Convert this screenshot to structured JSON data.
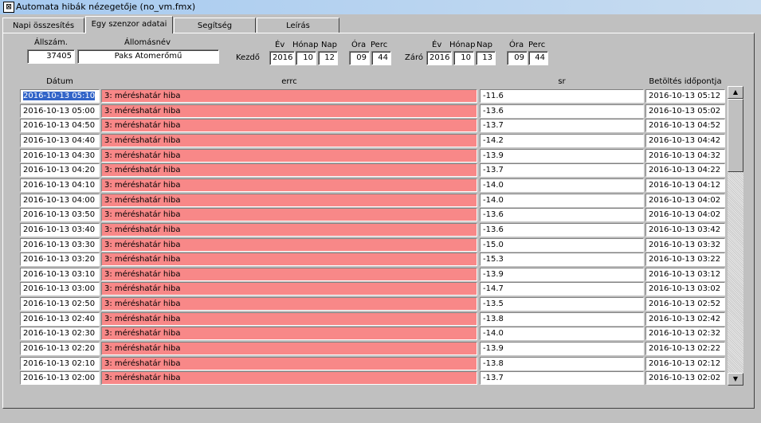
{
  "window": {
    "title": "Automata hibák nézegetője (no_vm.fmx)",
    "icon": "app-form-icon"
  },
  "tabs": [
    {
      "label": "Napi összesítés"
    },
    {
      "label": "Egy szenzor adatai"
    },
    {
      "label": "Segítség"
    },
    {
      "label": "Leírás"
    }
  ],
  "active_tab": "Egy szenzor adatai",
  "station": {
    "id_label": "Állszám.",
    "id_value": "37405",
    "name_label": "Állomásnév",
    "name_value": "Paks Atomerőmű"
  },
  "start": {
    "label": "Kezdő",
    "year_label": "Év",
    "month_label": "Hónap",
    "day_label": "Nap",
    "hour_label": "Óra",
    "minute_label": "Perc",
    "year": "2016",
    "month": "10",
    "day": "12",
    "hour": "09",
    "minute": "44"
  },
  "end": {
    "label": "Záró",
    "year_label": "Év",
    "month_label": "Hónap",
    "day_label": "Nap",
    "hour_label": "Óra",
    "minute_label": "Perc",
    "year": "2016",
    "month": "10",
    "day": "13",
    "hour": "09",
    "minute": "44"
  },
  "table": {
    "headers": {
      "date": "Dátum",
      "errc": "errc",
      "sr": "sr",
      "load": "Betöltés időpontja"
    },
    "rows": [
      {
        "date": "2016-10-13 05:10",
        "errc": "3: méréshatár hiba",
        "sr": "-11.6",
        "load": "2016-10-13 05:12"
      },
      {
        "date": "2016-10-13 05:00",
        "errc": "3: méréshatár hiba",
        "sr": "-13.6",
        "load": "2016-10-13 05:02"
      },
      {
        "date": "2016-10-13 04:50",
        "errc": "3: méréshatár hiba",
        "sr": "-13.7",
        "load": "2016-10-13 04:52"
      },
      {
        "date": "2016-10-13 04:40",
        "errc": "3: méréshatár hiba",
        "sr": "-14.2",
        "load": "2016-10-13 04:42"
      },
      {
        "date": "2016-10-13 04:30",
        "errc": "3: méréshatár hiba",
        "sr": "-13.9",
        "load": "2016-10-13 04:32"
      },
      {
        "date": "2016-10-13 04:20",
        "errc": "3: méréshatár hiba",
        "sr": "-13.7",
        "load": "2016-10-13 04:22"
      },
      {
        "date": "2016-10-13 04:10",
        "errc": "3: méréshatár hiba",
        "sr": "-14.0",
        "load": "2016-10-13 04:12"
      },
      {
        "date": "2016-10-13 04:00",
        "errc": "3: méréshatár hiba",
        "sr": "-14.0",
        "load": "2016-10-13 04:02"
      },
      {
        "date": "2016-10-13 03:50",
        "errc": "3: méréshatár hiba",
        "sr": "-13.6",
        "load": "2016-10-13 04:02"
      },
      {
        "date": "2016-10-13 03:40",
        "errc": "3: méréshatár hiba",
        "sr": "-13.6",
        "load": "2016-10-13 03:42"
      },
      {
        "date": "2016-10-13 03:30",
        "errc": "3: méréshatár hiba",
        "sr": "-15.0",
        "load": "2016-10-13 03:32"
      },
      {
        "date": "2016-10-13 03:20",
        "errc": "3: méréshatár hiba",
        "sr": "-15.3",
        "load": "2016-10-13 03:22"
      },
      {
        "date": "2016-10-13 03:10",
        "errc": "3: méréshatár hiba",
        "sr": "-13.9",
        "load": "2016-10-13 03:12"
      },
      {
        "date": "2016-10-13 03:00",
        "errc": "3: méréshatár hiba",
        "sr": "-14.7",
        "load": "2016-10-13 03:02"
      },
      {
        "date": "2016-10-13 02:50",
        "errc": "3: méréshatár hiba",
        "sr": "-13.5",
        "load": "2016-10-13 02:52"
      },
      {
        "date": "2016-10-13 02:40",
        "errc": "3: méréshatár hiba",
        "sr": "-13.8",
        "load": "2016-10-13 02:42"
      },
      {
        "date": "2016-10-13 02:30",
        "errc": "3: méréshatár hiba",
        "sr": "-14.0",
        "load": "2016-10-13 02:32"
      },
      {
        "date": "2016-10-13 02:20",
        "errc": "3: méréshatár hiba",
        "sr": "-13.9",
        "load": "2016-10-13 02:22"
      },
      {
        "date": "2016-10-13 02:10",
        "errc": "3: méréshatár hiba",
        "sr": "-13.8",
        "load": "2016-10-13 02:12"
      },
      {
        "date": "2016-10-13 02:00",
        "errc": "3: méréshatár hiba",
        "sr": "-13.7",
        "load": "2016-10-13 02:02"
      }
    ]
  },
  "scrollbar": {
    "up_icon": "scroll-up-arrow-icon",
    "down_icon": "scroll-down-arrow-icon"
  },
  "colors": {
    "error_cell": "#f88888",
    "selection": "#3264c8",
    "background": "#c0c0c0"
  }
}
